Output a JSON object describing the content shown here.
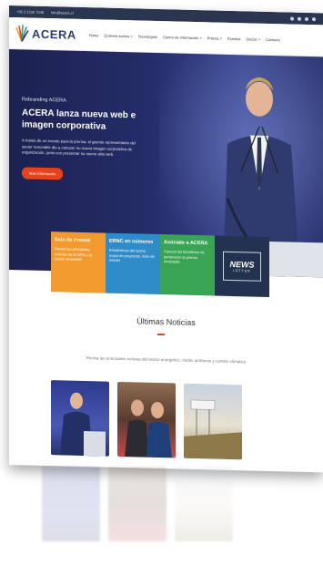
{
  "topbar": {
    "phone": "+56 2 2236 7348",
    "email": "info@acera.cl"
  },
  "brand": {
    "name": "ACERA"
  },
  "nav": {
    "items": [
      "Home",
      "Quiénes somos ˅",
      "Tecnologías",
      "Centro de información ˅",
      "Prensa ˅",
      "Eventos",
      "Socios ˅",
      "Contacto"
    ]
  },
  "hero": {
    "eyebrow": "Rebranding ACERA",
    "headline": "ACERA lanza nueva web e imagen corporativa",
    "body": "A través de un evento para la prensa, el gremio representante del sector renovable dio a conocer su nueva imagen corporativa de organización, junto con presentar su nuevo sitio web.",
    "cta": "Más información"
  },
  "tiles": [
    {
      "title": "Sala de Prensa",
      "desc": "Revisa las principales noticias de ACERA y el sector renovable",
      "color": "#f29a2e"
    },
    {
      "title": "ERNC en números",
      "desc": "Estadísticas del sector, mapa de proyectos, links de interés",
      "color": "#2f8cc8"
    },
    {
      "title": "Asóciate a ACERA",
      "desc": "Conoce los beneficios de pertenecer al gremio renovable",
      "color": "#3aa455"
    }
  ],
  "newsletter": {
    "word": "NEWS",
    "sub": "LETTER"
  },
  "news": {
    "title": "Últimas Noticias",
    "subtitle": "Revisa las principales noticias del sector energético, medio ambiente y cambio climático"
  }
}
